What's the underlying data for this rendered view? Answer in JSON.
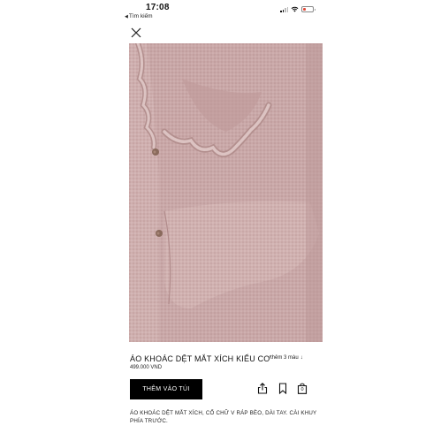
{
  "status_bar": {
    "time": "17:08",
    "back_label": "Tìm kiếm",
    "battery_color": "#e24a3b"
  },
  "header": {
    "close_icon": "close-icon"
  },
  "product": {
    "image_alt": "knit cardigan with ruffle collar in dusty pink",
    "title": "ÁO KHOÁC DỆT MẮT XÍCH KIỂU CƠ",
    "colors_link": "thêm 3 màu",
    "price": "499.000 VND",
    "add_to_bag": "THÊM VÀO TÚI",
    "description": "ÁO KHOÁC DỆT MẮT XÍCH, CỔ CHỮ V RÁP BÈO, DÀI TAY. CÀI KHUY PHÍA TRƯỚC.",
    "icons": [
      "share-icon",
      "bookmark-icon",
      "bag-icon"
    ],
    "bag_count": "0"
  }
}
